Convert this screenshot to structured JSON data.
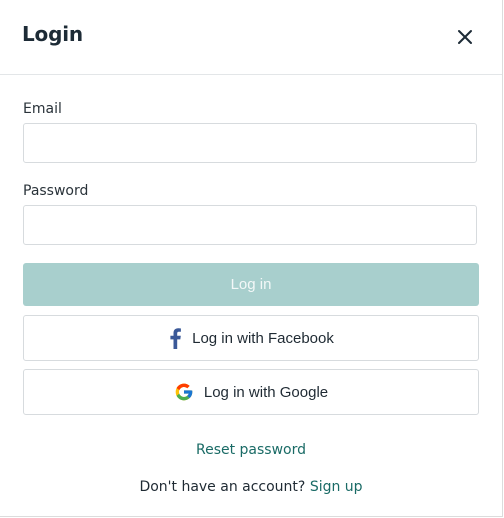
{
  "dialog": {
    "title": "Login",
    "close_icon": "close-icon"
  },
  "form": {
    "email_label": "Email",
    "email_value": "",
    "email_placeholder": "",
    "password_label": "Password",
    "password_value": "",
    "password_placeholder": "",
    "login_button": "Log in"
  },
  "social": {
    "facebook_label": "Log in with Facebook",
    "facebook_icon": "facebook-icon",
    "google_label": "Log in with Google",
    "google_icon": "google-icon"
  },
  "footer": {
    "reset_link": "Reset password",
    "signup_prompt": "Don't have an account?",
    "signup_link": "Sign up"
  },
  "colors": {
    "primary_button_bg": "#a8cfcd",
    "link": "#1a6b66",
    "facebook_blue": "#3b5998"
  }
}
